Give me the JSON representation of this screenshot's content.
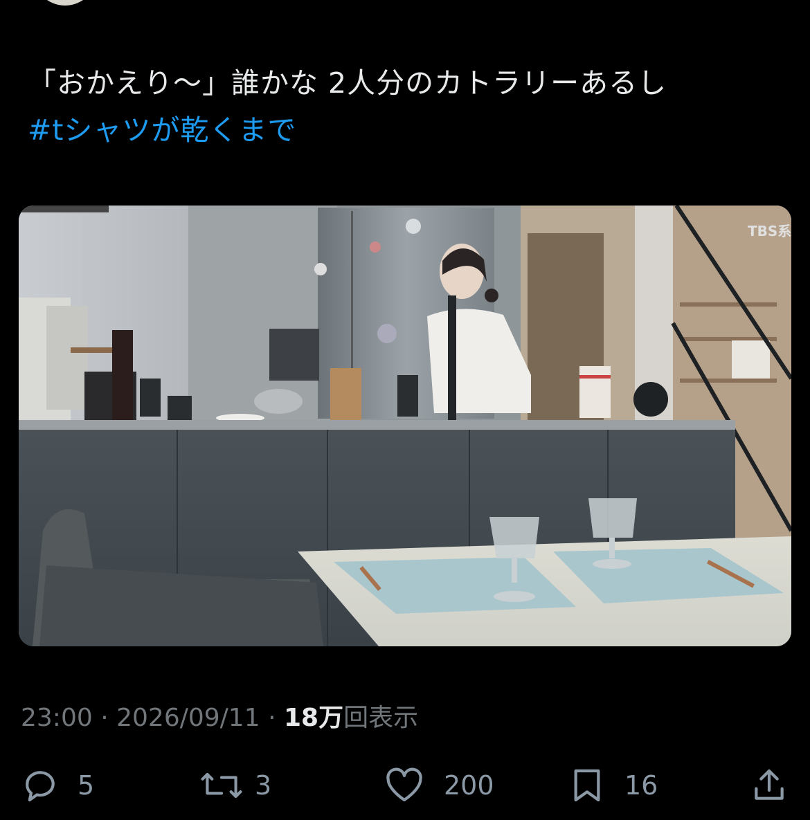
{
  "tweet": {
    "text_line1": "「おかえり〜」誰かな 2人分のカトラリーあるし",
    "hashtag": "#tシャツが乾くまで",
    "media": {
      "watermark": "TBS系",
      "icon": "kitchen-photo"
    },
    "time": "23:00",
    "date": "2026/09/11",
    "separator": "·",
    "views_count": "18万",
    "views_label": "回表示"
  },
  "actions": {
    "reply": {
      "icon": "reply-icon",
      "count": "5"
    },
    "retweet": {
      "icon": "retweet-icon",
      "count": "3"
    },
    "like": {
      "icon": "like-icon",
      "count": "200"
    },
    "bookmark": {
      "icon": "bookmark-icon",
      "count": "16"
    },
    "share": {
      "icon": "share-icon"
    }
  },
  "colors": {
    "background": "#000000",
    "text": "#e7e9ea",
    "hashtag": "#1d9bf0",
    "secondary": "#71767b",
    "icon": "#8b98a5"
  }
}
